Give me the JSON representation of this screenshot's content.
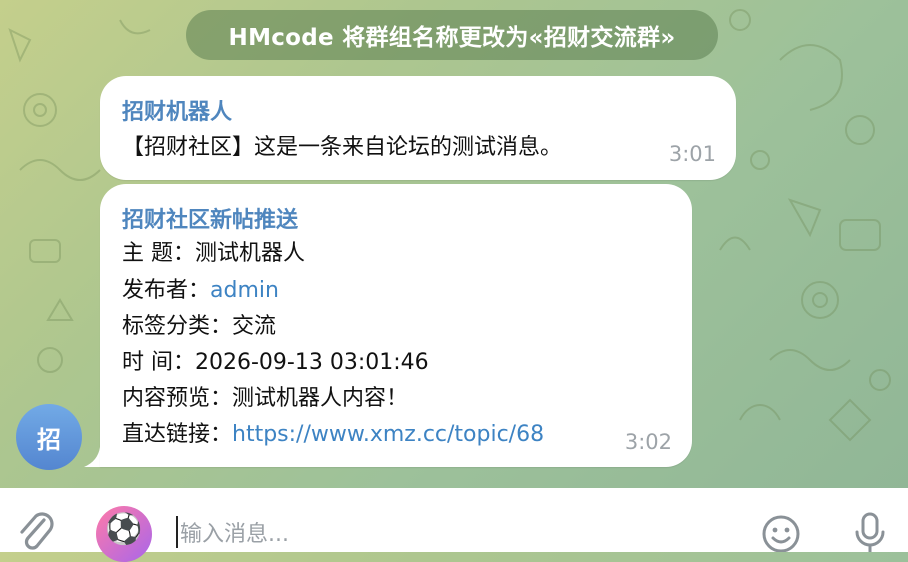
{
  "service_message": "HMcode 将群组名称更改为«招财交流群»",
  "messages": [
    {
      "sender": "招财机器人",
      "lines": [
        "【招财社区】这是一条来自论坛的测试消息。"
      ],
      "time": "3:01"
    },
    {
      "sender": "招财社区新帖推送",
      "subject_label": "主 题：",
      "subject_value": "测试机器人",
      "publisher_label": "发布者：",
      "publisher_value": "admin",
      "tags_label": "标签分类：",
      "tags_value": "交流",
      "time_label": "时 间：",
      "time_value": "2026-09-13 03:01:46",
      "preview_label": "内容预览：",
      "preview_value": "测试机器人内容！",
      "link_label": "直达链接：",
      "link_value": "https://www.xmz.cc/topic/68",
      "time": "3:02"
    }
  ],
  "sender_avatar": {
    "initial": "招",
    "color": "#5f93dc"
  },
  "composer": {
    "placeholder": "输入消息...",
    "bot_avatar_icon": "soccer-ball-icon",
    "attach_icon": "paperclip-icon",
    "emoji_icon": "smiley-icon",
    "mic_icon": "microphone-icon"
  },
  "colors": {
    "sender_name": "#4f86be",
    "link": "#3d83c3",
    "timestamp": "#9da3a8",
    "service_bg": "#5c8052"
  }
}
